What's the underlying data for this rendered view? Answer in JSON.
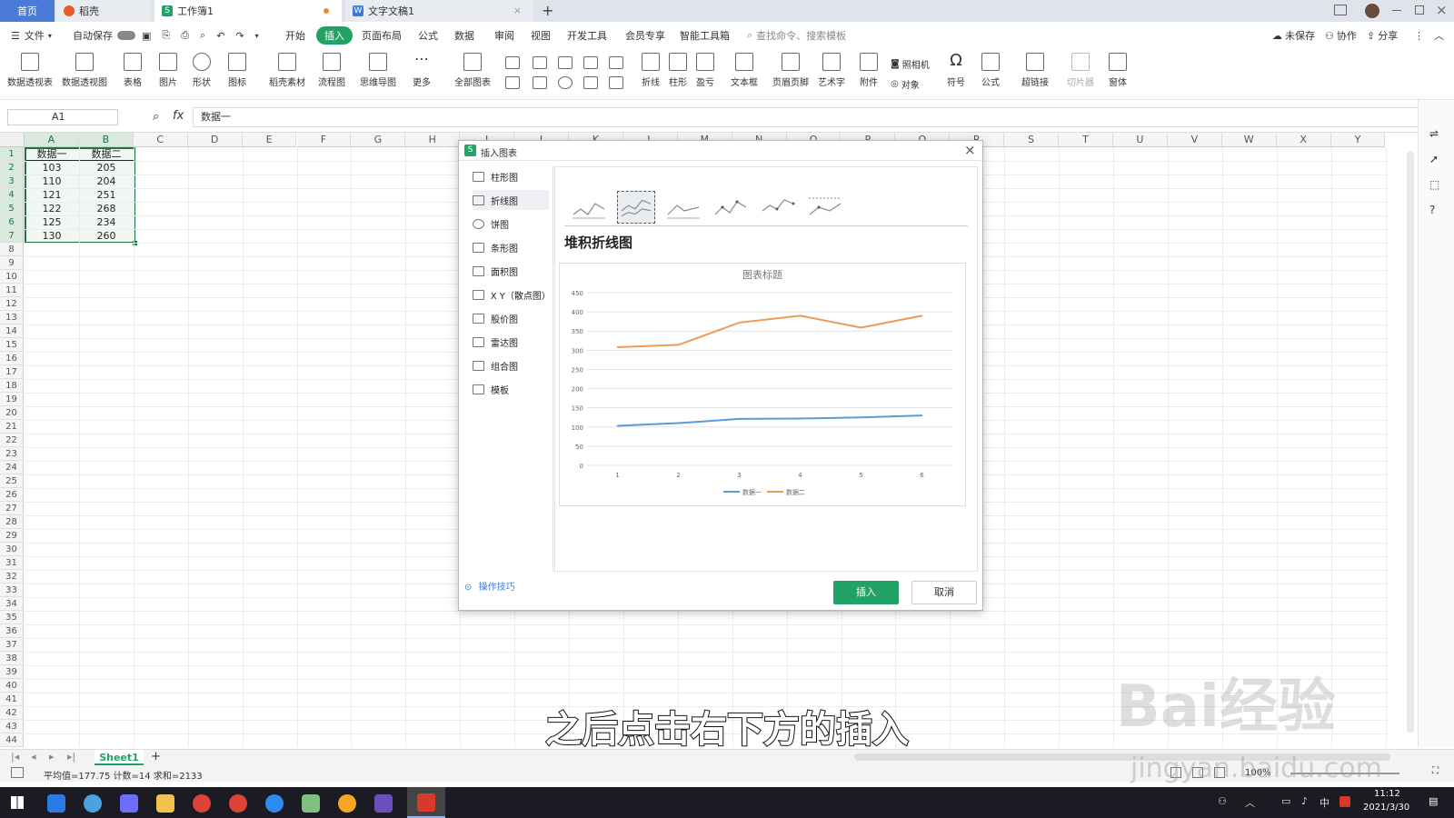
{
  "tabs": [
    {
      "label": "首页",
      "active": true
    },
    {
      "label": "稻壳",
      "icon": "daoke-icon"
    },
    {
      "label": "工作簿1",
      "icon": "spreadsheet-icon",
      "current": true
    },
    {
      "label": "文字文稿1",
      "icon": "writer-icon"
    }
  ],
  "tabbar": {
    "new_tab": "+"
  },
  "menubar": {
    "file": "文件",
    "autosave": "自动保存",
    "items": [
      "开始",
      "插入",
      "页面布局",
      "公式",
      "数据",
      "审阅",
      "视图",
      "开发工具",
      "会员专享",
      "智能工具箱"
    ],
    "active_index": 1,
    "search": "查找命令、搜索模板",
    "unsaved": "未保存",
    "collab": "协作",
    "share": "分享"
  },
  "ribbon": {
    "buttons": [
      "数据透视表",
      "数据透视图",
      "表格",
      "图片",
      "形状",
      "图标",
      "稻壳素材",
      "流程图",
      "思维导图",
      "更多",
      "全部图表"
    ],
    "buttons2": [
      "折线",
      "柱形",
      "盈亏",
      "文本框",
      "页眉页脚",
      "艺术字",
      "附件",
      "符号",
      "公式",
      "超链接",
      "切片器",
      "窗体"
    ],
    "camera": "照相机",
    "object": "对象"
  },
  "formula": {
    "namebox": "A1",
    "fx": "fx",
    "content": "数据一"
  },
  "columns": [
    "A",
    "B",
    "C",
    "D",
    "E",
    "F",
    "G",
    "H",
    "I",
    "J",
    "K",
    "L",
    "M",
    "N",
    "O",
    "P",
    "Q",
    "R",
    "S",
    "T",
    "U",
    "V",
    "W",
    "X",
    "Y"
  ],
  "rows": [
    "1",
    "2",
    "3",
    "4",
    "5",
    "6",
    "7",
    "8",
    "9",
    "10",
    "11",
    "12",
    "13",
    "14",
    "15",
    "16",
    "17",
    "18",
    "19",
    "20",
    "21",
    "22",
    "23",
    "24",
    "25",
    "26",
    "27",
    "28",
    "29",
    "30",
    "31",
    "32",
    "33",
    "34",
    "35",
    "36",
    "37",
    "38",
    "39",
    "40",
    "41",
    "42",
    "43",
    "44"
  ],
  "table": {
    "headers": [
      "数据一",
      "数据二"
    ],
    "rows": [
      [
        "103",
        "205"
      ],
      [
        "110",
        "204"
      ],
      [
        "121",
        "251"
      ],
      [
        "122",
        "268"
      ],
      [
        "125",
        "234"
      ],
      [
        "130",
        "260"
      ]
    ]
  },
  "dialog": {
    "title": "插入图表",
    "categories": [
      "柱形图",
      "折线图",
      "饼图",
      "条形图",
      "面积图",
      "X Y（散点图）",
      "股价图",
      "雷达图",
      "组合图",
      "模板"
    ],
    "selected_category": 1,
    "subtype_title": "堆积折线图",
    "tips": "操作技巧",
    "insert": "插入",
    "cancel": "取消"
  },
  "chart_data": {
    "type": "line",
    "title": "图表标题",
    "stacked": true,
    "x": [
      1,
      2,
      3,
      4,
      5,
      6
    ],
    "series": [
      {
        "name": "数据一",
        "values": [
          103,
          110,
          121,
          122,
          125,
          130
        ],
        "color": "#5b9bd5"
      },
      {
        "name": "数据二",
        "values": [
          308,
          314,
          372,
          390,
          359,
          390
        ],
        "color": "#ed9a53"
      }
    ],
    "ylim": [
      0,
      450
    ],
    "yticks": [
      0,
      50,
      100,
      150,
      200,
      250,
      300,
      350,
      400,
      450
    ],
    "xticks": [
      "1",
      "2",
      "3",
      "4",
      "5",
      "6"
    ],
    "legend": "bottom",
    "grid": true
  },
  "sheet": {
    "name": "Sheet1",
    "add": "+"
  },
  "status": {
    "summary": "平均值=177.75  计数=14  求和=2133",
    "zoom": "100%"
  },
  "taskbar": {
    "time": "11:12",
    "date": "2021/3/30",
    "ime": "中"
  },
  "subtitle": "之后点击右下方的插入",
  "watermark": {
    "text": "Bai经验",
    "url": "jingyan.baidu.com"
  },
  "colors": {
    "accent": "#21a366",
    "insert_button": "#21a366",
    "selection": "#217346"
  }
}
